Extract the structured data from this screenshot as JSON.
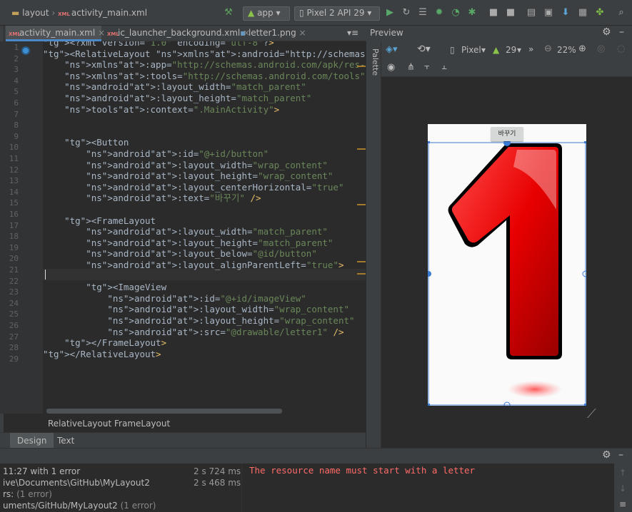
{
  "breadcrumbs": [
    "layout",
    "activity_main.xml"
  ],
  "toolbar": {
    "run_config": "app",
    "device": "Pixel 2 API 29"
  },
  "editor_tabs": [
    {
      "label": "activity_main.xml",
      "active": true
    },
    {
      "label": "ic_launcher_background.xml",
      "active": false
    },
    {
      "label": "letter1.png",
      "active": false
    }
  ],
  "tab_overflow": "≡",
  "code_lines": [
    {
      "n": "1",
      "text": "<?xml version=\"1.0\" encoding=\"utf-8\"?>"
    },
    {
      "n": "2",
      "text": "<RelativeLayout xmlns:android=\"http://schemas.android.com/apk"
    },
    {
      "n": "3",
      "text": "    xmlns:app=\"http://schemas.android.com/apk/res-auto\""
    },
    {
      "n": "4",
      "text": "    xmlns:tools=\"http://schemas.android.com/tools\""
    },
    {
      "n": "5",
      "text": "    android:layout_width=\"match_parent\""
    },
    {
      "n": "6",
      "text": "    android:layout_height=\"match_parent\""
    },
    {
      "n": "7",
      "text": "    tools:context=\".MainActivity\">"
    },
    {
      "n": "8",
      "text": ""
    },
    {
      "n": "9",
      "text": ""
    },
    {
      "n": "10",
      "text": "    <Button"
    },
    {
      "n": "11",
      "text": "        android:id=\"@+id/button\""
    },
    {
      "n": "12",
      "text": "        android:layout_width=\"wrap_content\""
    },
    {
      "n": "13",
      "text": "        android:layout_height=\"wrap_content\""
    },
    {
      "n": "14",
      "text": "        android:layout_centerHorizontal=\"true\""
    },
    {
      "n": "15",
      "text": "        android:text=\"바꾸기\" />"
    },
    {
      "n": "16",
      "text": ""
    },
    {
      "n": "17",
      "text": "    <FrameLayout"
    },
    {
      "n": "18",
      "text": "        android:layout_width=\"match_parent\""
    },
    {
      "n": "19",
      "text": "        android:layout_height=\"match_parent\""
    },
    {
      "n": "20",
      "text": "        android:layout_below=\"@id/button\""
    },
    {
      "n": "21",
      "text": "        android:layout_alignParentLeft=\"true\">"
    },
    {
      "n": "22",
      "text": ""
    },
    {
      "n": "23",
      "text": "        <ImageView"
    },
    {
      "n": "24",
      "text": "            android:id=\"@+id/imageView\""
    },
    {
      "n": "25",
      "text": "            android:layout_width=\"wrap_content\""
    },
    {
      "n": "26",
      "text": "            android:layout_height=\"wrap_content\""
    },
    {
      "n": "27",
      "text": "            android:src=\"@drawable/letter1\" />"
    },
    {
      "n": "28",
      "text": "    </FrameLayout>"
    },
    {
      "n": "29",
      "text": "</RelativeLayout>"
    }
  ],
  "structure_breadcrumb": [
    "RelativeLayout",
    "FrameLayout"
  ],
  "design_tabs": [
    {
      "label": "Design",
      "selected": true
    },
    {
      "label": "Text",
      "selected": false
    }
  ],
  "preview": {
    "title": "Preview",
    "palette_label": "Palette",
    "device": "Pixel",
    "api": "29",
    "zoom": "22%",
    "button_text": "바꾸기",
    "image_glyph": "1"
  },
  "build_log": [
    {
      "text": "11:27  with 1 error",
      "time": "2 s 724 ms"
    },
    {
      "text": "ive\\Documents\\GitHub\\MyLayout2",
      "time": "2 s 468 ms"
    },
    {
      "text": "rs:",
      "suffix": "(1 error)"
    },
    {
      "text": "uments/GitHub/MyLayout2",
      "suffix": "(1 error)"
    }
  ],
  "error_message": "The resource name must start with a letter",
  "colors": {
    "accent": "#4a88c7",
    "error": "#ff6b68",
    "run_green": "#59a869"
  }
}
